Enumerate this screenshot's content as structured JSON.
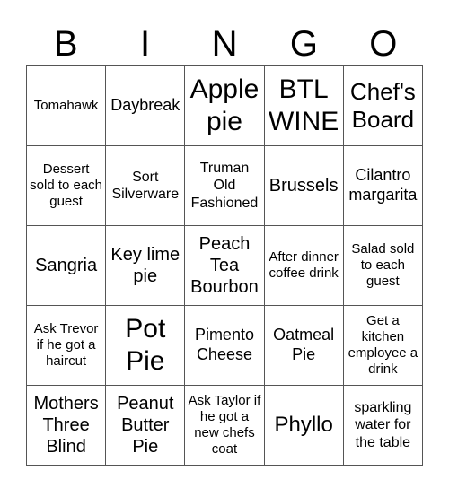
{
  "header": {
    "letters": [
      "B",
      "I",
      "N",
      "G",
      "O"
    ]
  },
  "grid": {
    "rows": [
      [
        "Tomahawk",
        "Daybreak",
        "Apple pie",
        "BTL WINE",
        "Chef's Board"
      ],
      [
        "Dessert sold to each guest",
        "Sort Silverware",
        "Truman Old Fashioned",
        "Brussels",
        "Cilantro margarita"
      ],
      [
        "Sangria",
        "Key lime pie",
        "Peach Tea Bourbon",
        "After dinner coffee drink",
        "Salad sold to each guest"
      ],
      [
        "Ask Trevor if he got a haircut",
        "Pot Pie",
        "Pimento Cheese",
        "Oatmeal Pie",
        "Get a kitchen employee a drink"
      ],
      [
        "Mothers Three Blind",
        "Peanut Butter Pie",
        "Ask Taylor if he got a new chefs coat",
        "Phyllo",
        "sparkling water for the table"
      ]
    ]
  }
}
